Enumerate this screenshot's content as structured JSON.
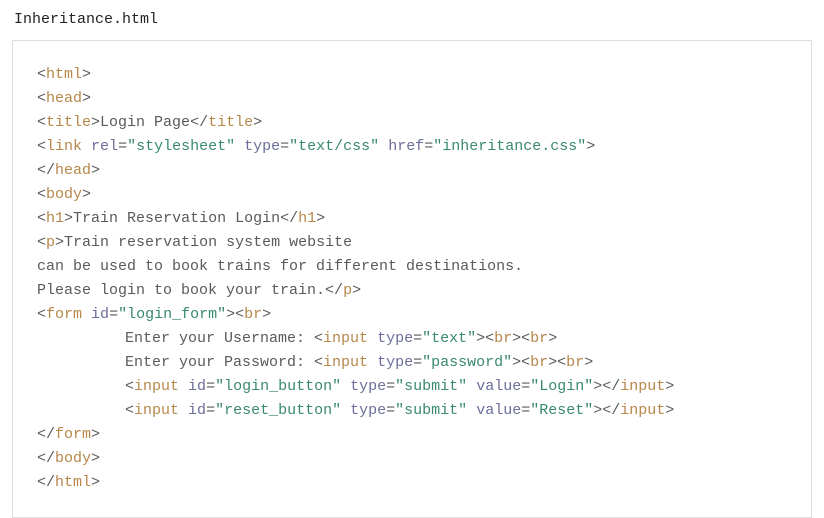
{
  "filename": "Inheritance.html",
  "code": {
    "title_text": "Login Page",
    "link_rel": "\"stylesheet\"",
    "link_type": "\"text/css\"",
    "link_href": "\"inheritance.css\"",
    "h1_text": "Train Reservation Login",
    "p_line1": "Train reservation system website",
    "p_line2": "can be used to book trains for different destinations.",
    "p_line3": "Please login to book your train.",
    "form_id": "\"login_form\"",
    "user_label": "Enter your Username: ",
    "user_type": "\"text\"",
    "pass_label": "Enter your Password: ",
    "pass_type": "\"password\"",
    "login_id": "\"login_button\"",
    "login_type": "\"submit\"",
    "login_value": "\"Login\"",
    "reset_id": "\"reset_button\"",
    "reset_type": "\"submit\"",
    "reset_value": "\"Reset\""
  }
}
